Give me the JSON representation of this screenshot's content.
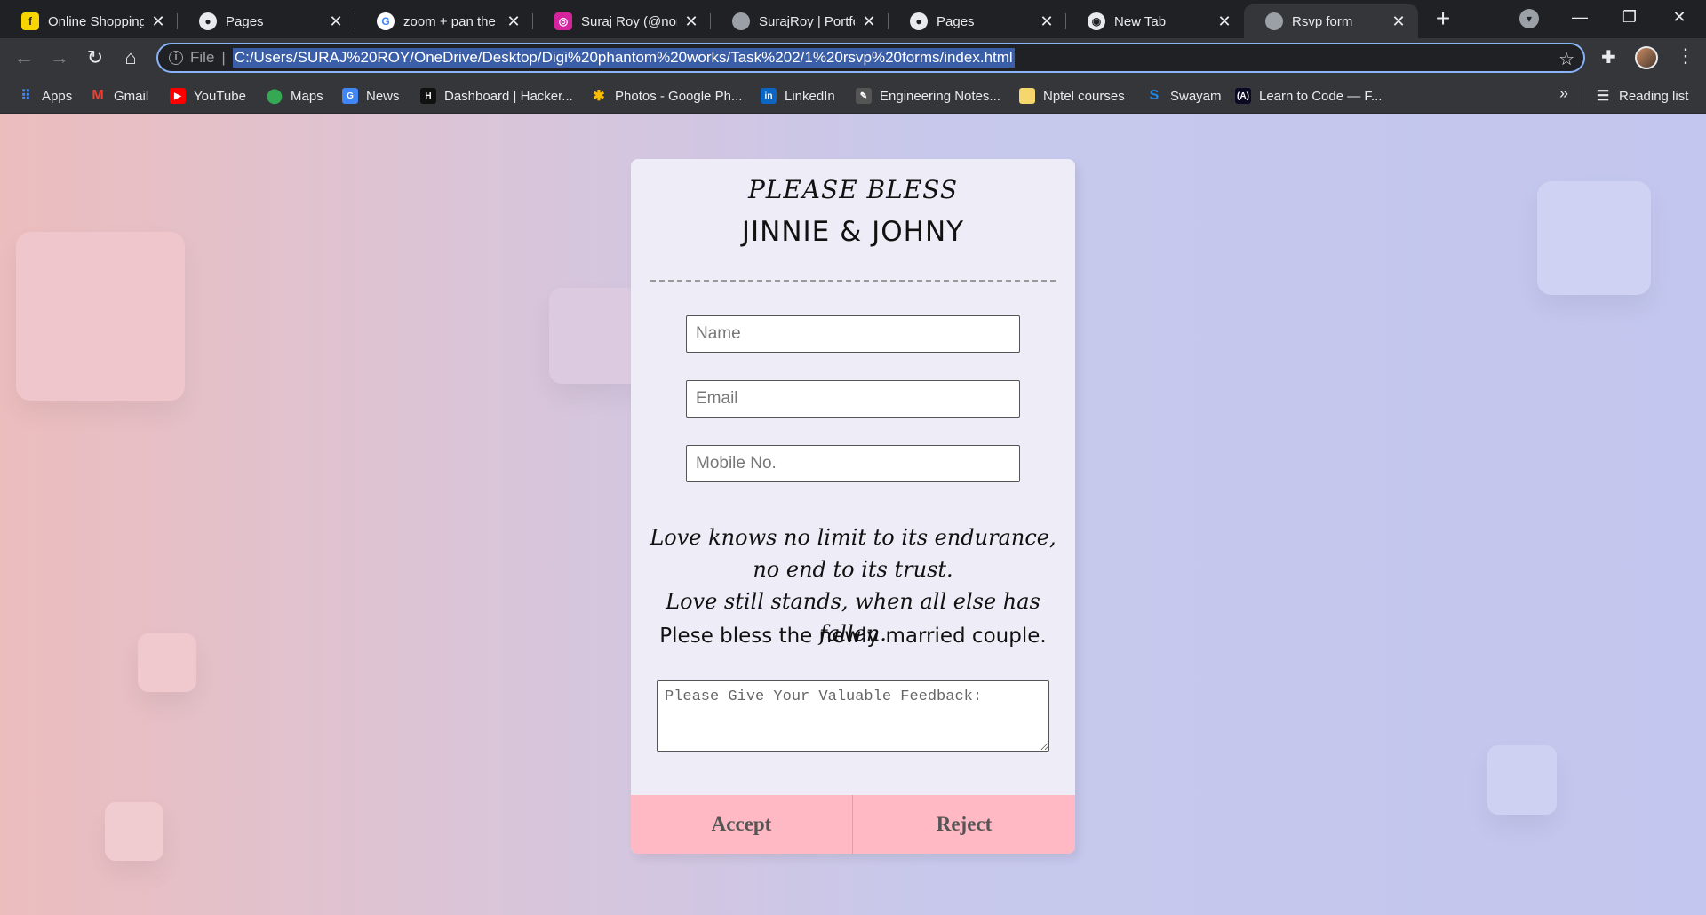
{
  "browser": {
    "tabs": [
      {
        "title": "Online Shopping",
        "favicon": "flipkart-icon",
        "color": "#f8d500"
      },
      {
        "title": "Pages",
        "favicon": "github-icon",
        "color": "#e8eaed"
      },
      {
        "title": "zoom + pan the ir",
        "favicon": "google-icon",
        "color": "#ffffff"
      },
      {
        "title": "Suraj Roy (@nom",
        "favicon": "instagram-icon",
        "color": "#d6249f"
      },
      {
        "title": "SurajRoy | Portfoli",
        "favicon": "globe-icon",
        "color": "#9aa0a6"
      },
      {
        "title": "Pages",
        "favicon": "github-icon",
        "color": "#e8eaed"
      },
      {
        "title": "New Tab",
        "favicon": "chrome-icon",
        "color": "#e8eaed"
      },
      {
        "title": "Rsvp form",
        "favicon": "globe-icon",
        "color": "#9aa0a6",
        "active": true
      }
    ],
    "omnibox": {
      "scheme_label": "File",
      "url": "C:/Users/SURAJ%20ROY/OneDrive/Desktop/Digi%20phantom%20works/Task%202/1%20rsvp%20forms/index.html"
    },
    "bookmarks": [
      {
        "label": "Apps",
        "icon": "apps-grid-icon",
        "color": "#4285f4"
      },
      {
        "label": "Gmail",
        "icon": "gmail-icon",
        "color": "#ea4335"
      },
      {
        "label": "YouTube",
        "icon": "youtube-icon",
        "color": "#ff0000"
      },
      {
        "label": "Maps",
        "icon": "maps-pin-icon",
        "color": "#34a853"
      },
      {
        "label": "News",
        "icon": "news-icon",
        "color": "#4285f4"
      },
      {
        "label": "Dashboard | Hacker...",
        "icon": "hackerrank-icon",
        "color": "#111111"
      },
      {
        "label": "Photos - Google Ph...",
        "icon": "photos-icon",
        "color": "#fbbc04"
      },
      {
        "label": "LinkedIn",
        "icon": "linkedin-icon",
        "color": "#0a66c2"
      },
      {
        "label": "Engineering Notes...",
        "icon": "notes-icon",
        "color": "#555555"
      },
      {
        "label": "Nptel courses",
        "icon": "folder-icon",
        "color": "#f5d76e"
      },
      {
        "label": "Swayam",
        "icon": "swayam-icon",
        "color": "#1e88e5"
      },
      {
        "label": "Learn to Code — F...",
        "icon": "freecodecamp-icon",
        "color": "#0a0a23"
      }
    ],
    "more_label": "»",
    "reading_list": "Reading list"
  },
  "form": {
    "heading_top": "PLEASE BLESS",
    "heading_names": "JINNIE & JOHNY",
    "name_placeholder": "Name",
    "email_placeholder": "Email",
    "mobile_placeholder": "Mobile No.",
    "poem_line1": "Love knows no limit to its endurance,",
    "poem_line2": "no end to its trust.",
    "poem_line3": "Love still stands, when all else has fallen.",
    "bless_line": "Plese bless the newly married couple.",
    "feedback_placeholder": "Please Give Your Valuable Feedback:",
    "accept_label": "Accept",
    "reject_label": "Reject"
  },
  "colors": {
    "accent_pink": "#ffb9c4",
    "card_bg": "#eeedf7",
    "gradient_left": "#ecbdbd",
    "gradient_right": "#c3c6ee"
  }
}
